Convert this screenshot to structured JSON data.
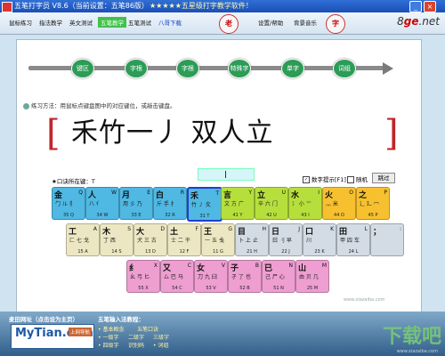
{
  "titlebar": {
    "title": "五笔打字员 V8.6（当前设置：五笔86版）",
    "subtitle": "★★★★★五星级打字教学软件！"
  },
  "menu": [
    {
      "label": "鼠标练习",
      "active": false
    },
    {
      "label": "指法教学",
      "active": false
    },
    {
      "label": "英文测试",
      "active": false
    },
    {
      "label": "五笔教学",
      "active": true
    },
    {
      "label": "五笔测试",
      "active": false
    },
    {
      "label": "八哥下载",
      "active": false,
      "link": true
    },
    {
      "label": "设置/帮助",
      "active": false
    },
    {
      "label": "背景音乐",
      "active": false
    }
  ],
  "header_icons": {
    "badge1": "老",
    "badge2": "字"
  },
  "logo": {
    "prefix": "8",
    "mid": "ge",
    "suffix": ".net"
  },
  "steps": [
    {
      "label": "键区",
      "color": "#2c9c57"
    },
    {
      "label": "字根",
      "color": "#c8a020"
    },
    {
      "label": "字根",
      "color": "#2c9c57"
    },
    {
      "label": "特殊字",
      "color": "#2c9c57"
    },
    {
      "label": "单字",
      "color": "#2c9c57"
    },
    {
      "label": "词组",
      "color": "#2c9c57"
    }
  ],
  "instructions": "练习方法：用鼠标点键盘图中的对应键位，或敲击键盘。",
  "practice": {
    "open": "[",
    "close": "]",
    "text": "禾竹一丿 双人立"
  },
  "prompt": {
    "label": "★口诀所在键：T"
  },
  "options": {
    "digit_hint": "数字提示[F1]",
    "random": "随机",
    "skip": "跳过"
  },
  "keys": [
    {
      "main": "金",
      "code": "Q",
      "sub": "勹 ル 犭",
      "num": "35 Q",
      "color": "#4fb8e3"
    },
    {
      "main": "人",
      "code": "W",
      "sub": "八 亻",
      "num": "34 W",
      "color": "#4fb8e3"
    },
    {
      "main": "月",
      "code": "E",
      "sub": "用 彡 乃",
      "num": "33 E",
      "color": "#4fb8e3"
    },
    {
      "main": "白",
      "code": "R",
      "sub": "斤 手 扌",
      "num": "32 R",
      "color": "#4fb8e3"
    },
    {
      "main": "禾",
      "code": "T",
      "sub": "竹 丿 夂",
      "num": "31 T",
      "color": "#4fb8e3",
      "selected": true
    },
    {
      "main": "言",
      "code": "Y",
      "sub": "文 方 广",
      "num": "41 Y",
      "color": "#b7df3c"
    },
    {
      "main": "立",
      "code": "U",
      "sub": "辛 六 门",
      "num": "42 U",
      "color": "#b7df3c"
    },
    {
      "main": "水",
      "code": "I",
      "sub": "氵 小 ⺌",
      "num": "43 I",
      "color": "#b7df3c"
    },
    {
      "main": "火",
      "code": "O",
      "sub": "灬 米",
      "num": "44 O",
      "color": "#f7c02f"
    },
    {
      "main": "之",
      "code": "P",
      "sub": "辶 廴 冖",
      "num": "45 P",
      "color": "#f7c02f"
    },
    {
      "main": "工",
      "code": "A",
      "sub": "匚 七 戈",
      "num": "15 A",
      "color": "#ece7c2"
    },
    {
      "main": "木",
      "code": "S",
      "sub": "丁 西",
      "num": "14 S",
      "color": "#ece7c2"
    },
    {
      "main": "大",
      "code": "D",
      "sub": "犬 三 古",
      "num": "13 D",
      "color": "#ece7c2"
    },
    {
      "main": "土",
      "code": "F",
      "sub": "士 二 干",
      "num": "12 F",
      "color": "#ece7c2"
    },
    {
      "main": "王",
      "code": "G",
      "sub": "一 五 戋",
      "num": "11 G",
      "color": "#ece7c2"
    },
    {
      "main": "目",
      "code": "H",
      "sub": "卜 上 止",
      "num": "21 H",
      "color": "#d3dbe4"
    },
    {
      "main": "日",
      "code": "J",
      "sub": "曰 刂 早",
      "num": "22 J",
      "color": "#d3dbe4"
    },
    {
      "main": "口",
      "code": "K",
      "sub": "川",
      "num": "23 K",
      "color": "#d3dbe4"
    },
    {
      "main": "田",
      "code": "L",
      "sub": "甲 四 车",
      "num": "24 L",
      "color": "#d3dbe4"
    },
    {
      "main": "；",
      "code": ":",
      "sub": "",
      "num": "",
      "color": "#d3dbe4"
    },
    {
      "main": "纟",
      "code": "X",
      "sub": "幺 弓 匕",
      "num": "55 X",
      "color": "#ee9ed0"
    },
    {
      "main": "又",
      "code": "C",
      "sub": "厶 巴 马",
      "num": "54 C",
      "color": "#ee9ed0"
    },
    {
      "main": "女",
      "code": "V",
      "sub": "刀 九 臼",
      "num": "53 V",
      "color": "#ee9ed0"
    },
    {
      "main": "子",
      "code": "B",
      "sub": "孑 了 也",
      "num": "52 B",
      "color": "#ee9ed0"
    },
    {
      "main": "已",
      "code": "N",
      "sub": "己 尸 心",
      "num": "51 N",
      "color": "#ee9ed0"
    },
    {
      "main": "山",
      "code": "M",
      "sub": "由 贝 几",
      "num": "25 M",
      "color": "#ee9ed0"
    }
  ],
  "bottom": {
    "site_title": "麦田网址（点击设为主页）",
    "site_logo": "MyTian.com",
    "site_badge": "上网导航",
    "method_title": "五笔输入法教程：",
    "method_items": [
      "• 基本概念",
      "五笔口诀",
      "• 一级字",
      "二级字",
      "三级字",
      "• 四级字",
      "识别码",
      "• 词组"
    ],
    "watermark": "下载吧",
    "watermark_url": "www.xiazaiba.com",
    "main_url": "www.xiazaiba.com"
  }
}
